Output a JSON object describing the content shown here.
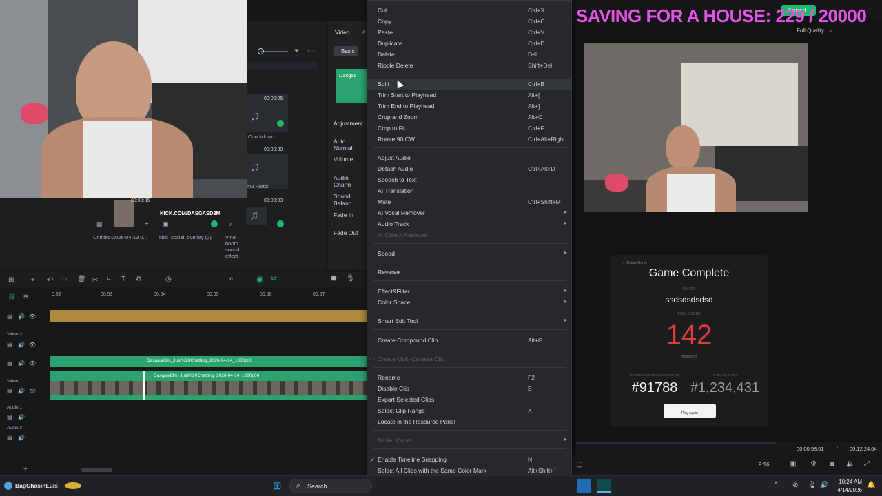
{
  "overlay": {
    "goal_text": "SAVING FOR A HOUSE: 229 / 20000"
  },
  "topbar": {
    "export_label": "Export",
    "quality_label": "Full Quality"
  },
  "properties": {
    "tabs": [
      "Video",
      "A"
    ],
    "basic_tab": "Basic",
    "clip_label": "Dasgas",
    "adjustment": "Adjustment",
    "rows": [
      "Auto Normali",
      "Volume",
      "Audio Chann",
      "Sound Balanc",
      "Fade In",
      "Fade Out"
    ]
  },
  "media": {
    "items": [
      {
        "duration": "00:00:05",
        "name": "Countdown ..."
      },
      {
        "duration": "00:00:30",
        "name": "m3 Farts!"
      },
      {
        "duration": "00:00:36",
        "name": "Untitled-2026-04-13 0..."
      },
      {
        "duration": "",
        "name": "kick_social_overlay (2)",
        "banner": "KICK.COM/DASGASD3M"
      },
      {
        "duration": "00:00:03",
        "name": "Vine boom sound effect"
      }
    ]
  },
  "context_menu": {
    "items": [
      {
        "label": "Cut",
        "shortcut": "Ctrl+X"
      },
      {
        "label": "Copy",
        "shortcut": "Ctrl+C"
      },
      {
        "label": "Paste",
        "shortcut": "Ctrl+V"
      },
      {
        "label": "Duplicate",
        "shortcut": "Ctrl+D"
      },
      {
        "label": "Delete",
        "shortcut": "Del"
      },
      {
        "label": "Ripple Delete",
        "shortcut": "Shift+Del"
      },
      {
        "label": "Split",
        "shortcut": "Ctrl+B"
      },
      {
        "label": "Trim Start to Playhead",
        "shortcut": "Alt+["
      },
      {
        "label": "Trim End to Playhead",
        "shortcut": "Alt+]"
      },
      {
        "label": "Crop and Zoom",
        "shortcut": "Alt+C"
      },
      {
        "label": "Crop to Fit",
        "shortcut": "Ctrl+F"
      },
      {
        "label": "Rotate 90 CW",
        "shortcut": "Ctrl+Alt+Right"
      },
      {
        "label": "Adjust Audio",
        "shortcut": ""
      },
      {
        "label": "Detach Audio",
        "shortcut": "Ctrl+Alt+D"
      },
      {
        "label": "Speech to Text",
        "shortcut": ""
      },
      {
        "label": "AI Translation",
        "shortcut": ""
      },
      {
        "label": "Mute",
        "shortcut": "Ctrl+Shift+M"
      },
      {
        "label": "AI Vocal Remover",
        "shortcut": ""
      },
      {
        "label": "Audio Track",
        "shortcut": ""
      },
      {
        "label": "AI Object Remover",
        "shortcut": ""
      },
      {
        "label": "Speed",
        "shortcut": ""
      },
      {
        "label": "Reverse",
        "shortcut": ""
      },
      {
        "label": "Effect&Filter",
        "shortcut": ""
      },
      {
        "label": "Color Space",
        "shortcut": ""
      },
      {
        "label": "Smart Edit Tool",
        "shortcut": ""
      },
      {
        "label": "Create Compound Clip",
        "shortcut": "Alt+G"
      },
      {
        "label": "Create Multi-Camera Clip",
        "shortcut": ""
      },
      {
        "label": "Rename",
        "shortcut": "F2"
      },
      {
        "label": "Disable Clip",
        "shortcut": "E"
      },
      {
        "label": "Export Selected Clips",
        "shortcut": ""
      },
      {
        "label": "Select Clip Range",
        "shortcut": "X"
      },
      {
        "label": "Locate in the Resource Panel",
        "shortcut": ""
      },
      {
        "label": "Bezier Curve",
        "shortcut": ""
      },
      {
        "label": "Enable Timeline Snapping",
        "shortcut": "N",
        "check": "✓"
      },
      {
        "label": "Select All Clips with the Same Color Mark",
        "shortcut": "Alt+Shift+`"
      }
    ],
    "swatch_colors": [
      "#b5474f",
      "#c0603c",
      "#b38a32",
      "#2f9b8f",
      "#2e78b8",
      "#5c5fc4",
      "#8a55b5",
      "#7a7d80",
      "#5fa640",
      "#8aa83a",
      "#b0a03a",
      "#c05a4a",
      "#a08a30"
    ]
  },
  "game": {
    "back": "← Return Home",
    "title": "Game Complete",
    "player_label": "PLAYER",
    "player": "ssdsdsdsdsd",
    "score_label": "FINAL SCORE",
    "score": "142",
    "score_sub": "repetitions",
    "rank_label": "CURRENT LEADERBOARD RANK",
    "rank": "#91788",
    "overall_label": "OVERALL RANK",
    "overall": "#1,234,431",
    "play_again": "Play Again"
  },
  "player_bar": {
    "current": "00:00:58:01",
    "sep": "/",
    "total": "00:12:24:04",
    "ratio": "9:16"
  },
  "timeline": {
    "ruler": [
      "0:52",
      "00:53",
      "00:54",
      "00:55",
      "00:56",
      "00:57"
    ],
    "track_labels": [
      "Video 3",
      "Video 1",
      "Audio 1",
      "Audio 2"
    ],
    "clip_a": "Dasgasd3m_Just%20Chatting_2026-04-14_1080p60",
    "clip_b": "Dasgasd3m_Just%20Chatting_2026-04-14_1080p60"
  },
  "taskbar": {
    "user": "BagChasinLuis",
    "search": "Search",
    "time": "10:24 AM",
    "date": "4/14/2026"
  }
}
